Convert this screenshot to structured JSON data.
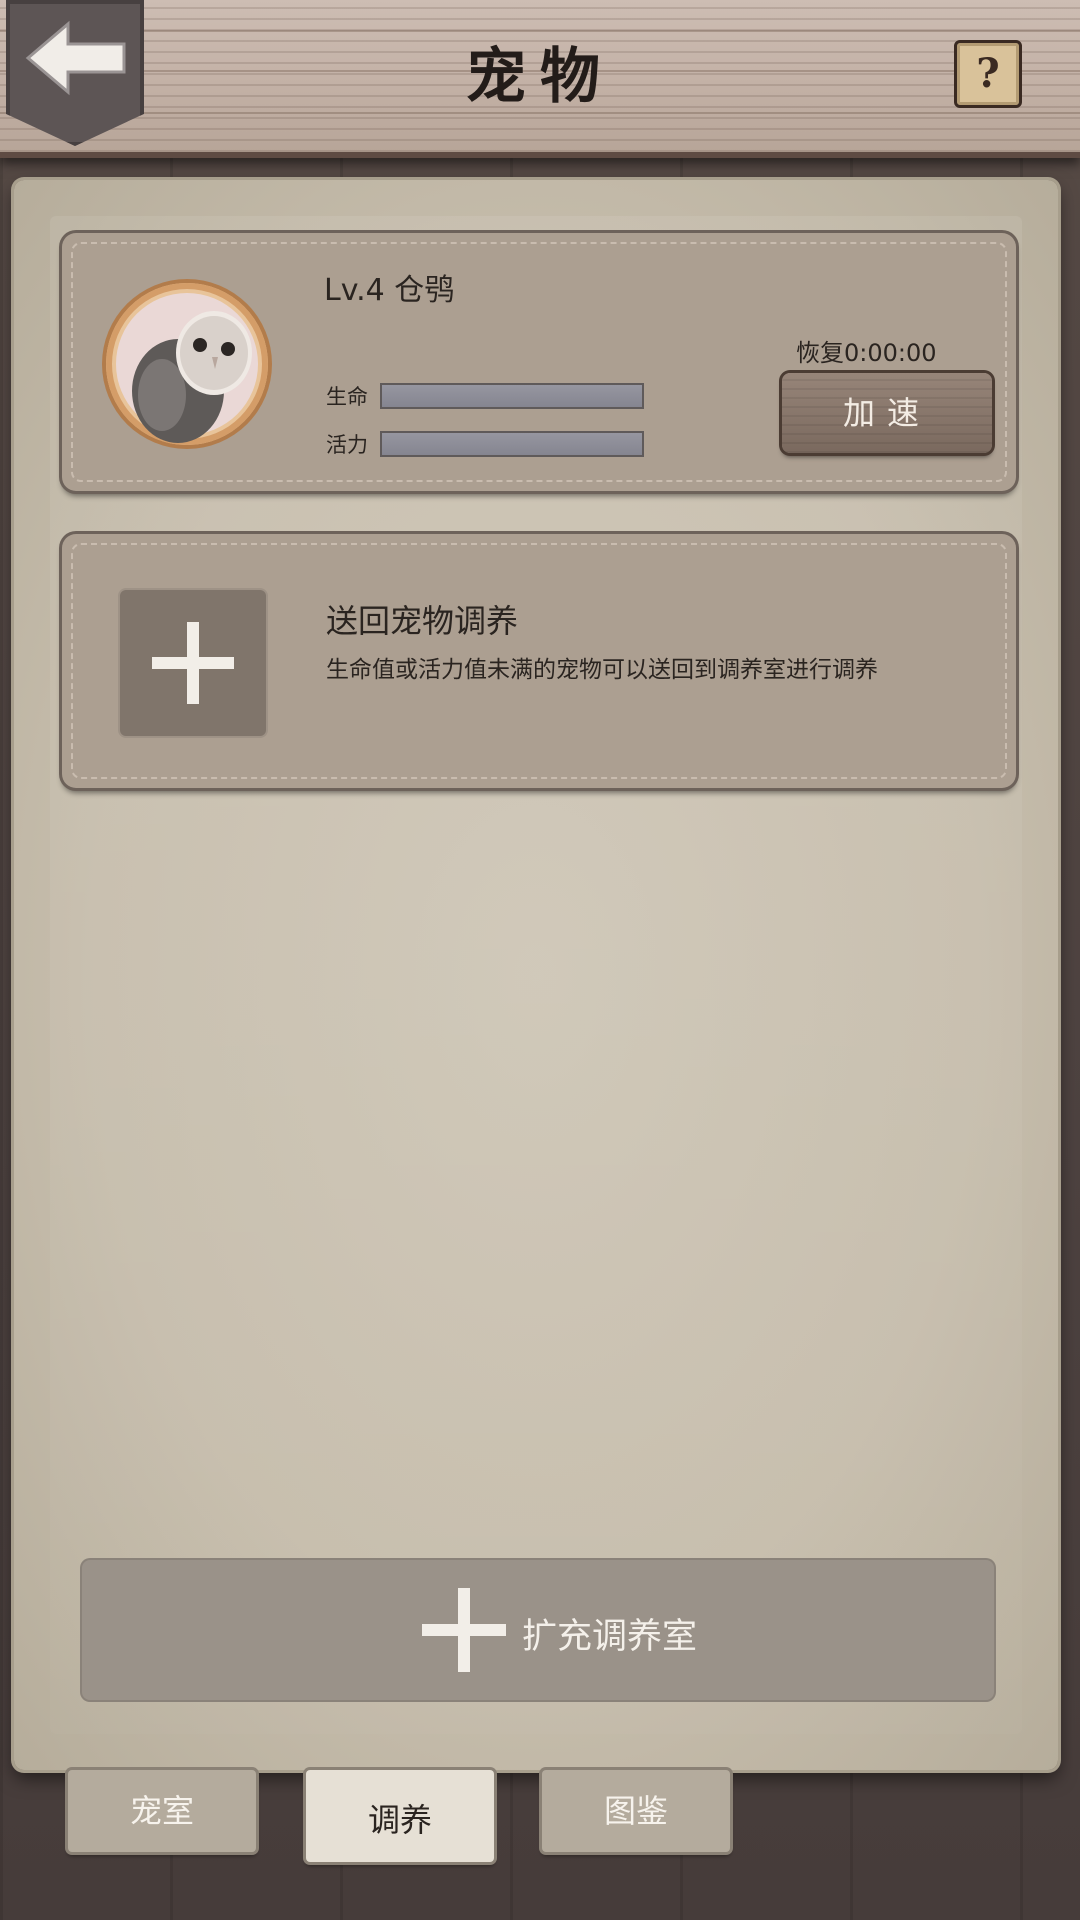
{
  "header": {
    "title": "宠物",
    "back_icon": "arrow-left-icon",
    "help_label": "?"
  },
  "pet": {
    "avatar_icon": "barn-owl-portrait",
    "name": "Lv.4  仓鸮",
    "stats": [
      {
        "label": "生命",
        "fill": 1.0
      },
      {
        "label": "活力",
        "fill": 1.0
      }
    ],
    "recover_text": "恢复0:00:00",
    "speed_button": "加速"
  },
  "slot": {
    "title": "送回宠物调养",
    "description": "生命值或活力值未满的宠物可以送回到调养室进行调养"
  },
  "expand": {
    "label": "扩充调养室"
  },
  "tabs": [
    {
      "label": "宠室",
      "active": false
    },
    {
      "label": "调养",
      "active": true
    },
    {
      "label": "图鉴",
      "active": false
    }
  ],
  "colors": {
    "wood_header": "#c3b1a6",
    "parchment": "#c6bdac",
    "card": "#ac9f91",
    "stat_bar": "#8c8c96"
  }
}
